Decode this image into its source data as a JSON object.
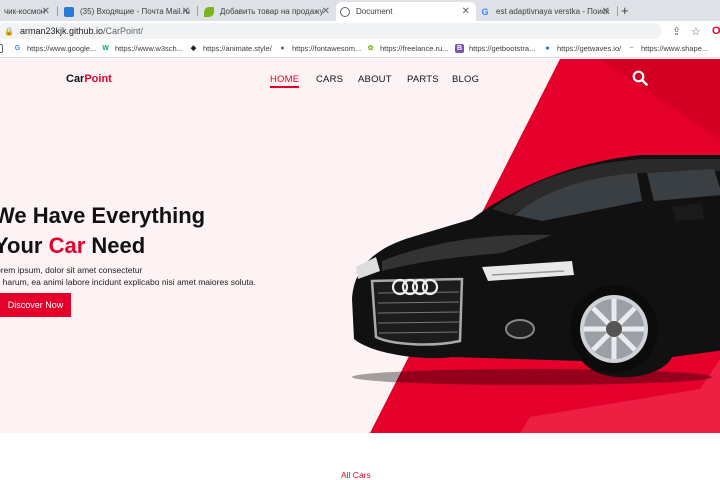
{
  "browser": {
    "tabs": [
      {
        "title": "чик-космон",
        "favicon": "generic",
        "active": false
      },
      {
        "title": "(35) Входящие - Почта Mail.ru",
        "favicon": "mail-icon",
        "active": false
      },
      {
        "title": "Добавить товар на продажу",
        "favicon": "leaf-icon",
        "active": false
      },
      {
        "title": "Document",
        "favicon": "globe-icon",
        "active": true
      },
      {
        "title": "est adaptivnaya verstka - Поиск",
        "favicon": "google-icon",
        "active": false
      }
    ],
    "new_tab": "+",
    "close_glyph": "✕",
    "address": {
      "host": "arman23kjk.github.io",
      "path": "/CarPoint/"
    },
    "bookmarks": [
      {
        "label": "https://www.google...",
        "icon": "G",
        "color": "#4285f4"
      },
      {
        "label": "https://www.w3sch...",
        "icon": "W",
        "color": "#04aa6d"
      },
      {
        "label": "https://animate.style/",
        "icon": "◆",
        "color": "#222222"
      },
      {
        "label": "https://fontawesom...",
        "icon": "●",
        "color": "#666666"
      },
      {
        "label": "https://freelance.ru...",
        "icon": "✿",
        "color": "#7ab51d"
      },
      {
        "label": "https://getbootstra...",
        "icon": "B",
        "color": "#7952b3"
      },
      {
        "label": "https://getwaves.io/",
        "icon": "●",
        "color": "#1e5bd8"
      },
      {
        "label": "https://www.shape...",
        "icon": "~",
        "color": "#999999"
      }
    ]
  },
  "site": {
    "logo": {
      "part1": "Car",
      "part2": "Point"
    },
    "nav": [
      "HOME",
      "CARS",
      "ABOUT",
      "PARTS",
      "BLOG"
    ],
    "active_nav": "HOME",
    "hero": {
      "line1": "We Have Everything",
      "line2_pre": "Your ",
      "line2_accent": "Car",
      "line2_post": " Need",
      "sub1": "orem ipsum, dolor sit amet consectetur",
      "sub2": "s harum, ea animi labore incidunt explicabo nisi amet maiores soluta.",
      "cta": "Discover Now"
    },
    "section_title": "All Cars",
    "colors": {
      "accent": "#e4002b",
      "hero_bg": "#fdf3f4"
    }
  }
}
